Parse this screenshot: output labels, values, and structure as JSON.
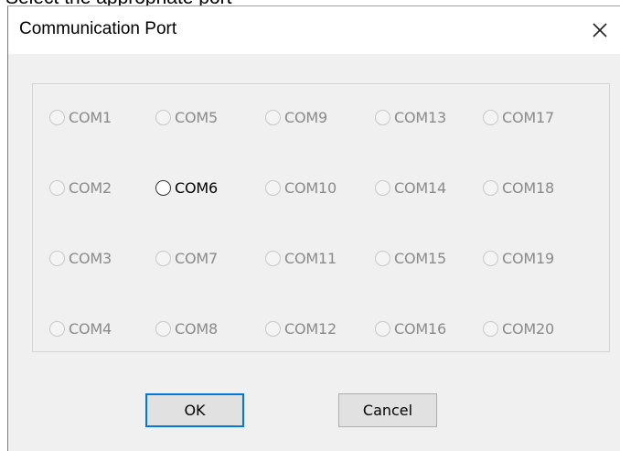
{
  "background": {
    "partial_text": "Select the appropriate port"
  },
  "dialog": {
    "title": "Communication Port",
    "close_glyph": "×",
    "ports": [
      {
        "label": "COM1",
        "enabled": false
      },
      {
        "label": "COM2",
        "enabled": false
      },
      {
        "label": "COM3",
        "enabled": false
      },
      {
        "label": "COM4",
        "enabled": false
      },
      {
        "label": "COM5",
        "enabled": false
      },
      {
        "label": "COM6",
        "enabled": true
      },
      {
        "label": "COM7",
        "enabled": false
      },
      {
        "label": "COM8",
        "enabled": false
      },
      {
        "label": "COM9",
        "enabled": false
      },
      {
        "label": "COM10",
        "enabled": false
      },
      {
        "label": "COM11",
        "enabled": false
      },
      {
        "label": "COM12",
        "enabled": false
      },
      {
        "label": "COM13",
        "enabled": false
      },
      {
        "label": "COM14",
        "enabled": false
      },
      {
        "label": "COM15",
        "enabled": false
      },
      {
        "label": "COM16",
        "enabled": false
      },
      {
        "label": "COM17",
        "enabled": false
      },
      {
        "label": "COM18",
        "enabled": false
      },
      {
        "label": "COM19",
        "enabled": false
      },
      {
        "label": "COM20",
        "enabled": false
      }
    ],
    "ok_label": "OK",
    "cancel_label": "Cancel"
  },
  "colors": {
    "focus_border": "#0078d7",
    "disabled_text": "#8a8a8a",
    "dialog_background": "#f0f0f0"
  },
  "icons": {
    "close": "close-icon",
    "radio": "radio-button"
  }
}
